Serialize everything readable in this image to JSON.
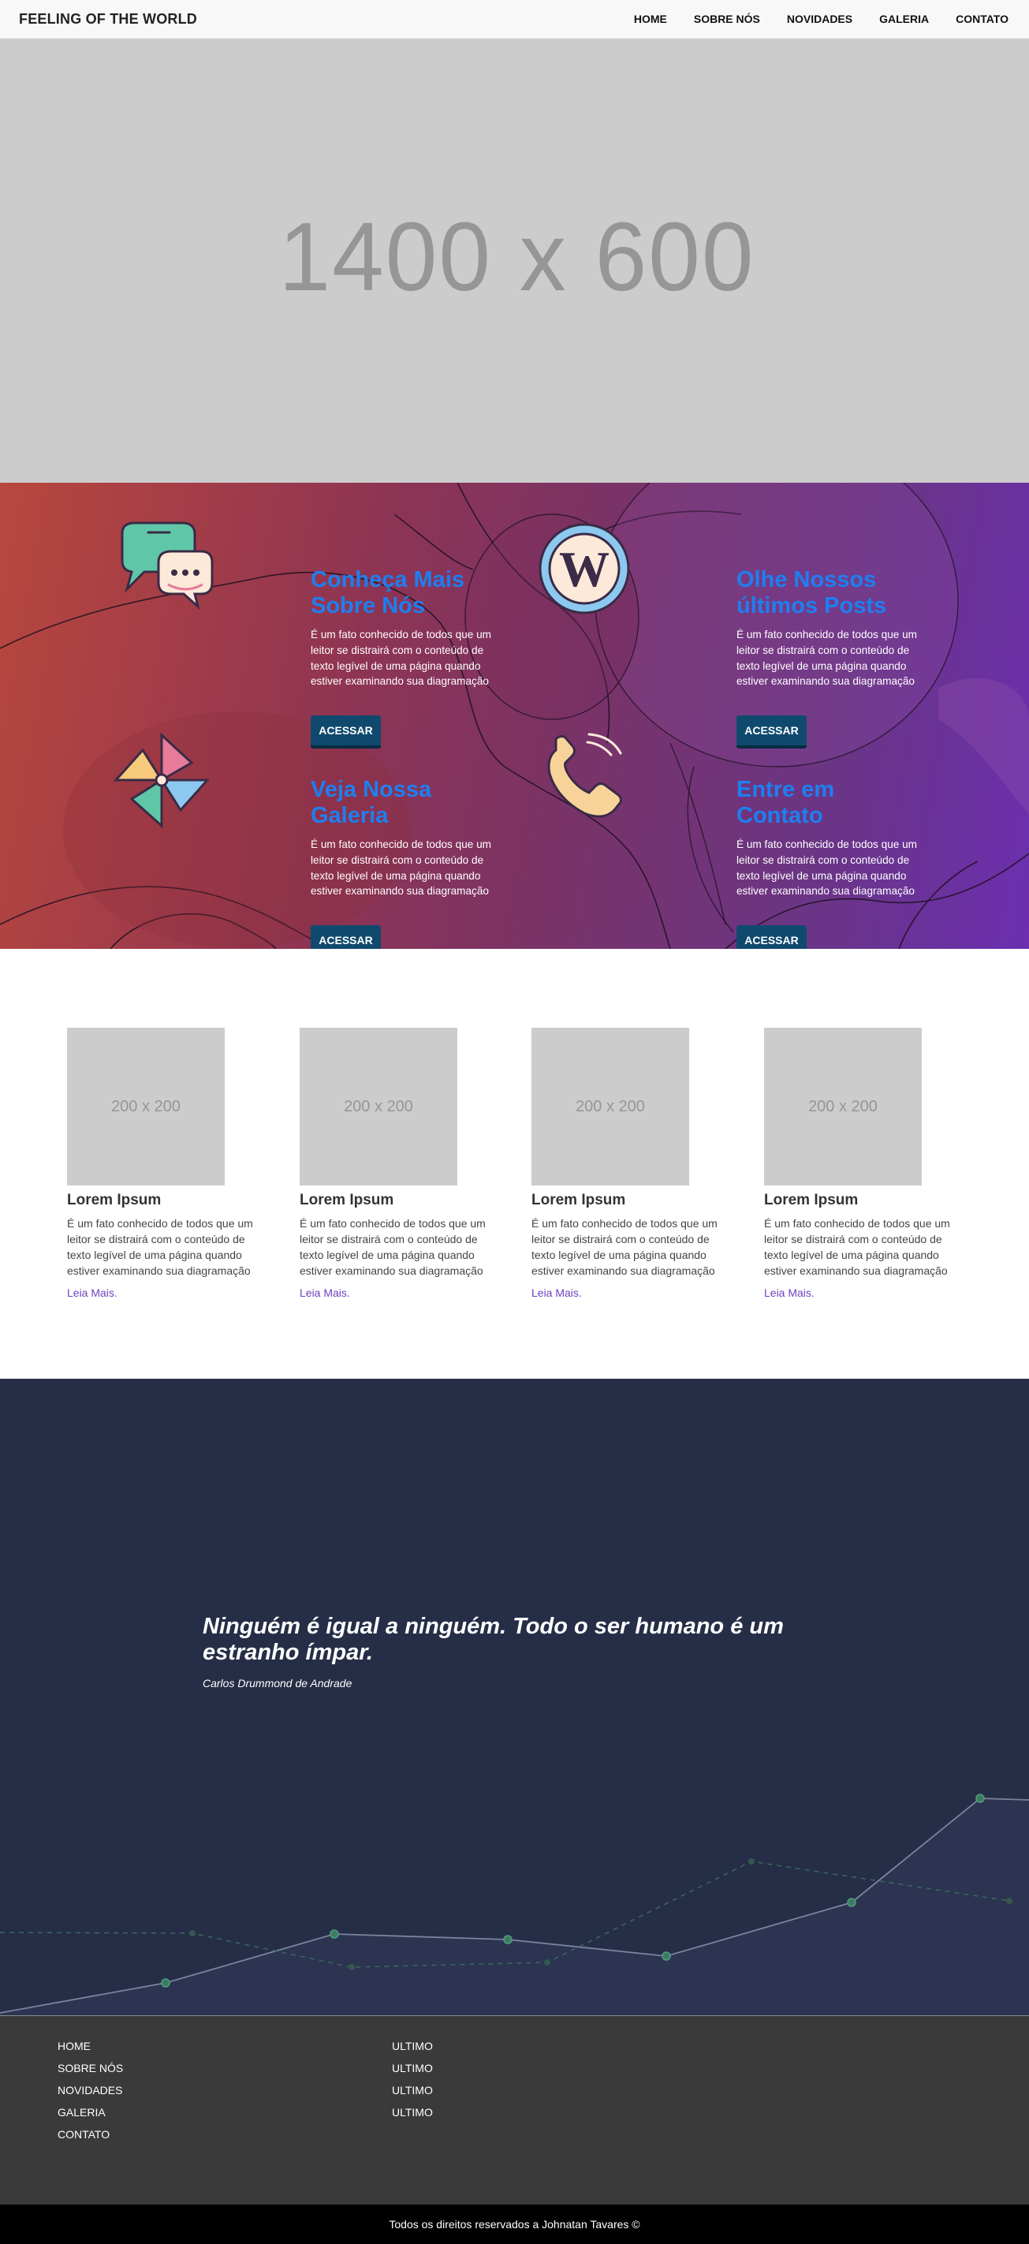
{
  "navbar": {
    "brand": "FEELING OF THE WORLD",
    "links": [
      "HOME",
      "SOBRE NÓS",
      "NOVIDADES",
      "GALERIA",
      "CONTATO"
    ]
  },
  "hero": {
    "placeholder": "1400 x 600"
  },
  "features": [
    {
      "icon": "chat-bubbles-icon",
      "title": "Conheça Mais Sobre Nós",
      "text": "É um fato conhecido de todos que um leitor se distrairá com o conteúdo de texto legível de uma página quando estiver examinando sua diagramação",
      "button": "ACESSAR"
    },
    {
      "icon": "wordpress-logo-icon",
      "title": "Olhe Nossos últimos Posts",
      "text": "É um fato conhecido de todos que um leitor se distrairá com o conteúdo de texto legível de uma página quando estiver examinando sua diagramação",
      "button": "ACESSAR"
    },
    {
      "icon": "pinwheel-icon",
      "title": "Veja Nossa Galeria",
      "text": "É um fato conhecido de todos que um leitor se distrairá com o conteúdo de texto legível de uma página quando estiver examinando sua diagramação",
      "button": "ACESSAR"
    },
    {
      "icon": "phone-handset-icon",
      "title": "Entre em Contato",
      "text": "É um fato conhecido de todos que um leitor se distrairá com o conteúdo de texto legível de uma página quando estiver examinando sua diagramação",
      "button": "ACESSAR"
    }
  ],
  "cards": [
    {
      "thumb": "200 x 200",
      "title": "Lorem Ipsum",
      "text": "É um fato conhecido de todos que um leitor se distrairá com o conteúdo de texto legível de uma página quando estiver examinando sua diagramação",
      "link": "Leia Mais."
    },
    {
      "thumb": "200 x 200",
      "title": "Lorem Ipsum",
      "text": "É um fato conhecido de todos que um leitor se distrairá com o conteúdo de texto legível de uma página quando estiver examinando sua diagramação",
      "link": "Leia Mais."
    },
    {
      "thumb": "200 x 200",
      "title": "Lorem Ipsum",
      "text": "É um fato conhecido de todos que um leitor se distrairá com o conteúdo de texto legível de uma página quando estiver examinando sua diagramação",
      "link": "Leia Mais."
    },
    {
      "thumb": "200 x 200",
      "title": "Lorem Ipsum",
      "text": "É um fato conhecido de todos que um leitor se distrairá com o conteúdo de texto legível de uma página quando estiver examinando sua diagramação",
      "link": "Leia Mais."
    }
  ],
  "quote": {
    "text": "Ninguém é igual a ninguém. Todo o ser humano é um estranho ímpar.",
    "author": "Carlos Drummond de Andrade"
  },
  "footer": {
    "col1": [
      "HOME",
      "SOBRE NÓS",
      "NOVIDADES",
      "GALERIA",
      "CONTATO"
    ],
    "col2": [
      "ULTIMO",
      "ULTIMO",
      "ULTIMO",
      "ULTIMO"
    ],
    "copyright": "Todos os direitos reservados a Johnatan Tavares ©"
  },
  "colors": {
    "feature_title": "#1e7ff0",
    "feature_button": "#0f4a6e",
    "link_purple": "#6f42c1",
    "quote_bg": "#262e47",
    "footer_bg": "#3a3a3a"
  }
}
